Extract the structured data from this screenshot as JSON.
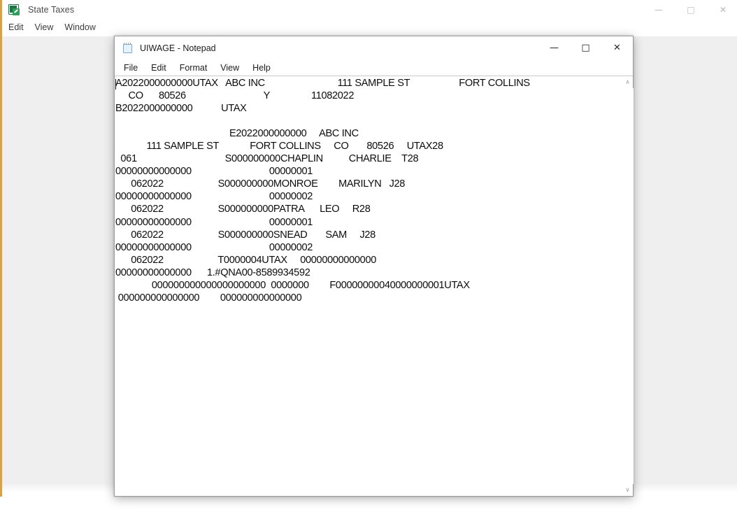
{
  "background_window": {
    "title": "State Taxes",
    "icon": "spreadsheet-icon",
    "menu": [
      {
        "label": "Edit"
      },
      {
        "label": "View"
      },
      {
        "label": "Window"
      }
    ],
    "window_controls": {
      "minimize": "—",
      "maximize": "□",
      "close": "✕"
    }
  },
  "notepad": {
    "title": "UIWAGE - Notepad",
    "icon": "notepad-icon",
    "menu": [
      {
        "label": "File"
      },
      {
        "label": "Edit"
      },
      {
        "label": "Format"
      },
      {
        "label": "View"
      },
      {
        "label": "Help"
      }
    ],
    "window_controls": {
      "minimize": "—",
      "maximize": "□",
      "close": "✕"
    },
    "scrollbar": {
      "up_arrow": "∧",
      "down_arrow": "∨"
    },
    "content": "A2022000000000UTAX   ABC INC                            111 SAMPLE ST                   FORT COLLINS\n     CO      80526                              Y                11082022\nB2022000000000           UTAX\n\n                                            E2022000000000     ABC INC\n            111 SAMPLE ST            FORT COLLINS     CO       80526     UTAX28\n  061                                  S000000000CHAPLIN          CHARLIE    T28\n00000000000000                              00000001\n      062022                     S000000000MONROE        MARILYN   J28\n00000000000000                              00000002\n      062022                     S000000000PATRA      LEO     R28\n00000000000000                              00000001\n      062022                     S000000000SNEAD       SAM     J28\n00000000000000                              00000002\n      062022                     T0000004UTAX     00000000000000\n00000000000000      1.#QNA00-8589934592\n              000000000000000000000  0000000        F00000000040000000001UTAX\n 000000000000000        000000000000000"
  }
}
